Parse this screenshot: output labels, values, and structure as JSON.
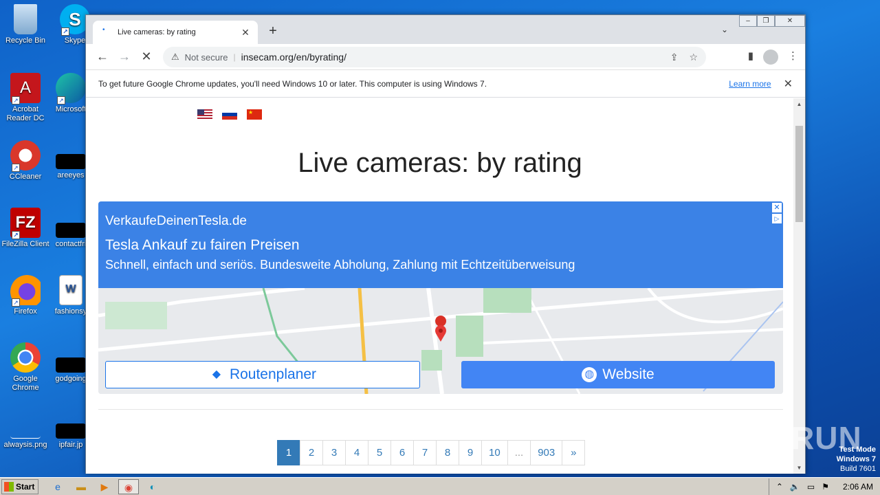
{
  "desktop": {
    "icons": [
      {
        "label": "Recycle Bin"
      },
      {
        "label": "Skype"
      },
      {
        "label": "Acrobat Reader DC"
      },
      {
        "label": "Microsoft"
      },
      {
        "label": "CCleaner"
      },
      {
        "label": "areeyes"
      },
      {
        "label": "FileZilla Client"
      },
      {
        "label": "contactfri"
      },
      {
        "label": "Firefox"
      },
      {
        "label": "fashionsy"
      },
      {
        "label": "Google Chrome"
      },
      {
        "label": "godgoing"
      },
      {
        "label": "alwaysis.png"
      },
      {
        "label": "ipfair.jp"
      }
    ]
  },
  "browser": {
    "tab_title": "Live cameras: by rating",
    "security_label": "Not secure",
    "url": "insecam.org/en/byrating/",
    "infobar_message": "To get future Google Chrome updates, you'll need Windows 10 or later. This computer is using Windows 7.",
    "infobar_link": "Learn more"
  },
  "page": {
    "title": "Live cameras: by rating",
    "flags": [
      "us-flag",
      "russia-flag",
      "china-flag"
    ],
    "ad": {
      "domain": "VerkaufeDeinenTesla.de",
      "headline": "Tesla Ankauf zu fairen Preisen",
      "description": "Schnell, einfach und seriös. Bundesweite Abholung, Zahlung mit Echtzeitüberweisung",
      "route_button": "Routenplaner",
      "website_button": "Website",
      "accent_color": "#3b82e6"
    },
    "pagination": {
      "pages": [
        "1",
        "2",
        "3",
        "4",
        "5",
        "6",
        "7",
        "8",
        "9",
        "10",
        "...",
        "903",
        "»"
      ],
      "active": "1"
    }
  },
  "taskbar": {
    "start_label": "Start",
    "clock": "2:06 AM"
  },
  "watermark": {
    "text": "ANY RUN",
    "test_mode": "Test Mode",
    "os": "Windows 7",
    "build": "Build 7601"
  }
}
